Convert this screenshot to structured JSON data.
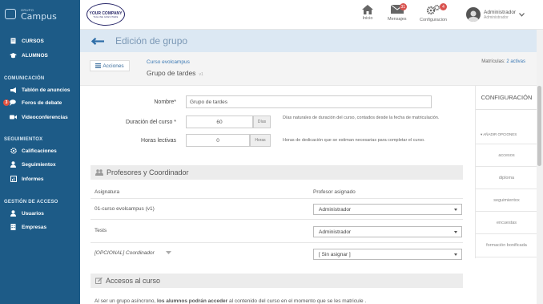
{
  "brand": {
    "small": "GRUPO",
    "big": "Campus"
  },
  "sidebar": {
    "items": [
      {
        "label": "CURSOS",
        "icon": "book-icon"
      },
      {
        "label": "ALUMNOS",
        "icon": "graduation-icon"
      }
    ],
    "sections": [
      {
        "title": "COMUNICACIÓN",
        "items": [
          "Tablón de anuncios",
          "Foros de debate",
          "Videoconferencias"
        ],
        "badge": "3"
      },
      {
        "title": "SEGUIMIENTOX",
        "items": [
          "Calificaciones",
          "Seguimientox",
          "Informes"
        ]
      },
      {
        "title": "GESTIÓN DE ACCESO",
        "items": [
          "Usuarios",
          "Empresas"
        ]
      }
    ]
  },
  "header": {
    "company_line1": "YOUR COMPANY",
    "company_line2": "TAGLINE GOES HERE",
    "inicio": "Inicio",
    "mensajes": "Mensajes",
    "mensajes_badge": "31",
    "config": "Configuracion",
    "config_badge": "4",
    "user_name": "Administrador",
    "user_role": "Administrador"
  },
  "page": {
    "title": "Edición de grupo"
  },
  "subheader": {
    "acciones": "Acciones",
    "course_link": "Curso evolcampus",
    "group_name": "Grupo de tardes",
    "group_rev": "v1",
    "matric_label": "Matrículas:",
    "matric_link": "2 activas"
  },
  "form": {
    "nombre_label": "Nombre*",
    "nombre_value": "Grupo de tardes",
    "duracion_label": "Duración del curso *",
    "duracion_value": "60",
    "duracion_unit": "Días",
    "duracion_help": "Días naturales de duración del curso, contados desde la fecha de matriculación.",
    "horas_label": "Horas lectivas",
    "horas_value": "0",
    "horas_unit": "Horas",
    "horas_help": "Horas de dedicación que se estiman necesarias para completar el curso."
  },
  "profesores": {
    "title": "Profesores y Coordinador",
    "col_asignatura": "Asignatura",
    "col_profesor": "Profesor asignado",
    "rows": [
      {
        "asignatura": "01-curso evolcampus (v1)",
        "profesor": "Administrador"
      },
      {
        "asignatura": "Tests",
        "profesor": "Administrador"
      },
      {
        "asignatura": "[OPCIONAL] Coordinador",
        "profesor": "[ Sin asignar ]"
      }
    ]
  },
  "accesos": {
    "title": "Accesos al curso",
    "text_prefix": "Al ser un grupo asíncrono, ",
    "text_bold": "los alumnos podrán acceder",
    "text_suffix": " al contenido del curso en el momento que se les matricule ."
  },
  "right_panel": {
    "tab": "CONFIGURACIÓN",
    "section": "AÑADIR OPCIONES",
    "items": [
      "accesos",
      "diploma",
      "seguimientox",
      "encuestas",
      "formación bonificada"
    ]
  },
  "colors": {
    "sidebar": "#1d5b87",
    "title_band": "#dce8f3",
    "link": "#3a78b3",
    "badge": "#d9534f"
  }
}
